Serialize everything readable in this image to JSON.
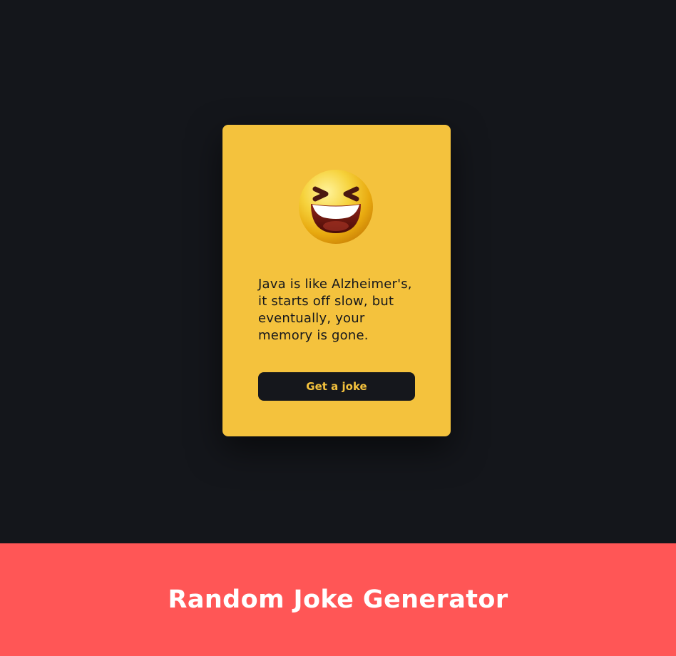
{
  "card": {
    "emoji_icon": "laughing-face-icon",
    "joke": "Java is like Alzheimer's, it starts off slow, but eventually, your memory is gone.",
    "button_label": "Get a joke"
  },
  "footer": {
    "title": "Random Joke Generator"
  },
  "colors": {
    "background": "#14161b",
    "card": "#f4c23d",
    "button": "#15171c",
    "button_text": "#f4c23d",
    "footer": "#ff5656",
    "footer_text": "#ffffff"
  }
}
